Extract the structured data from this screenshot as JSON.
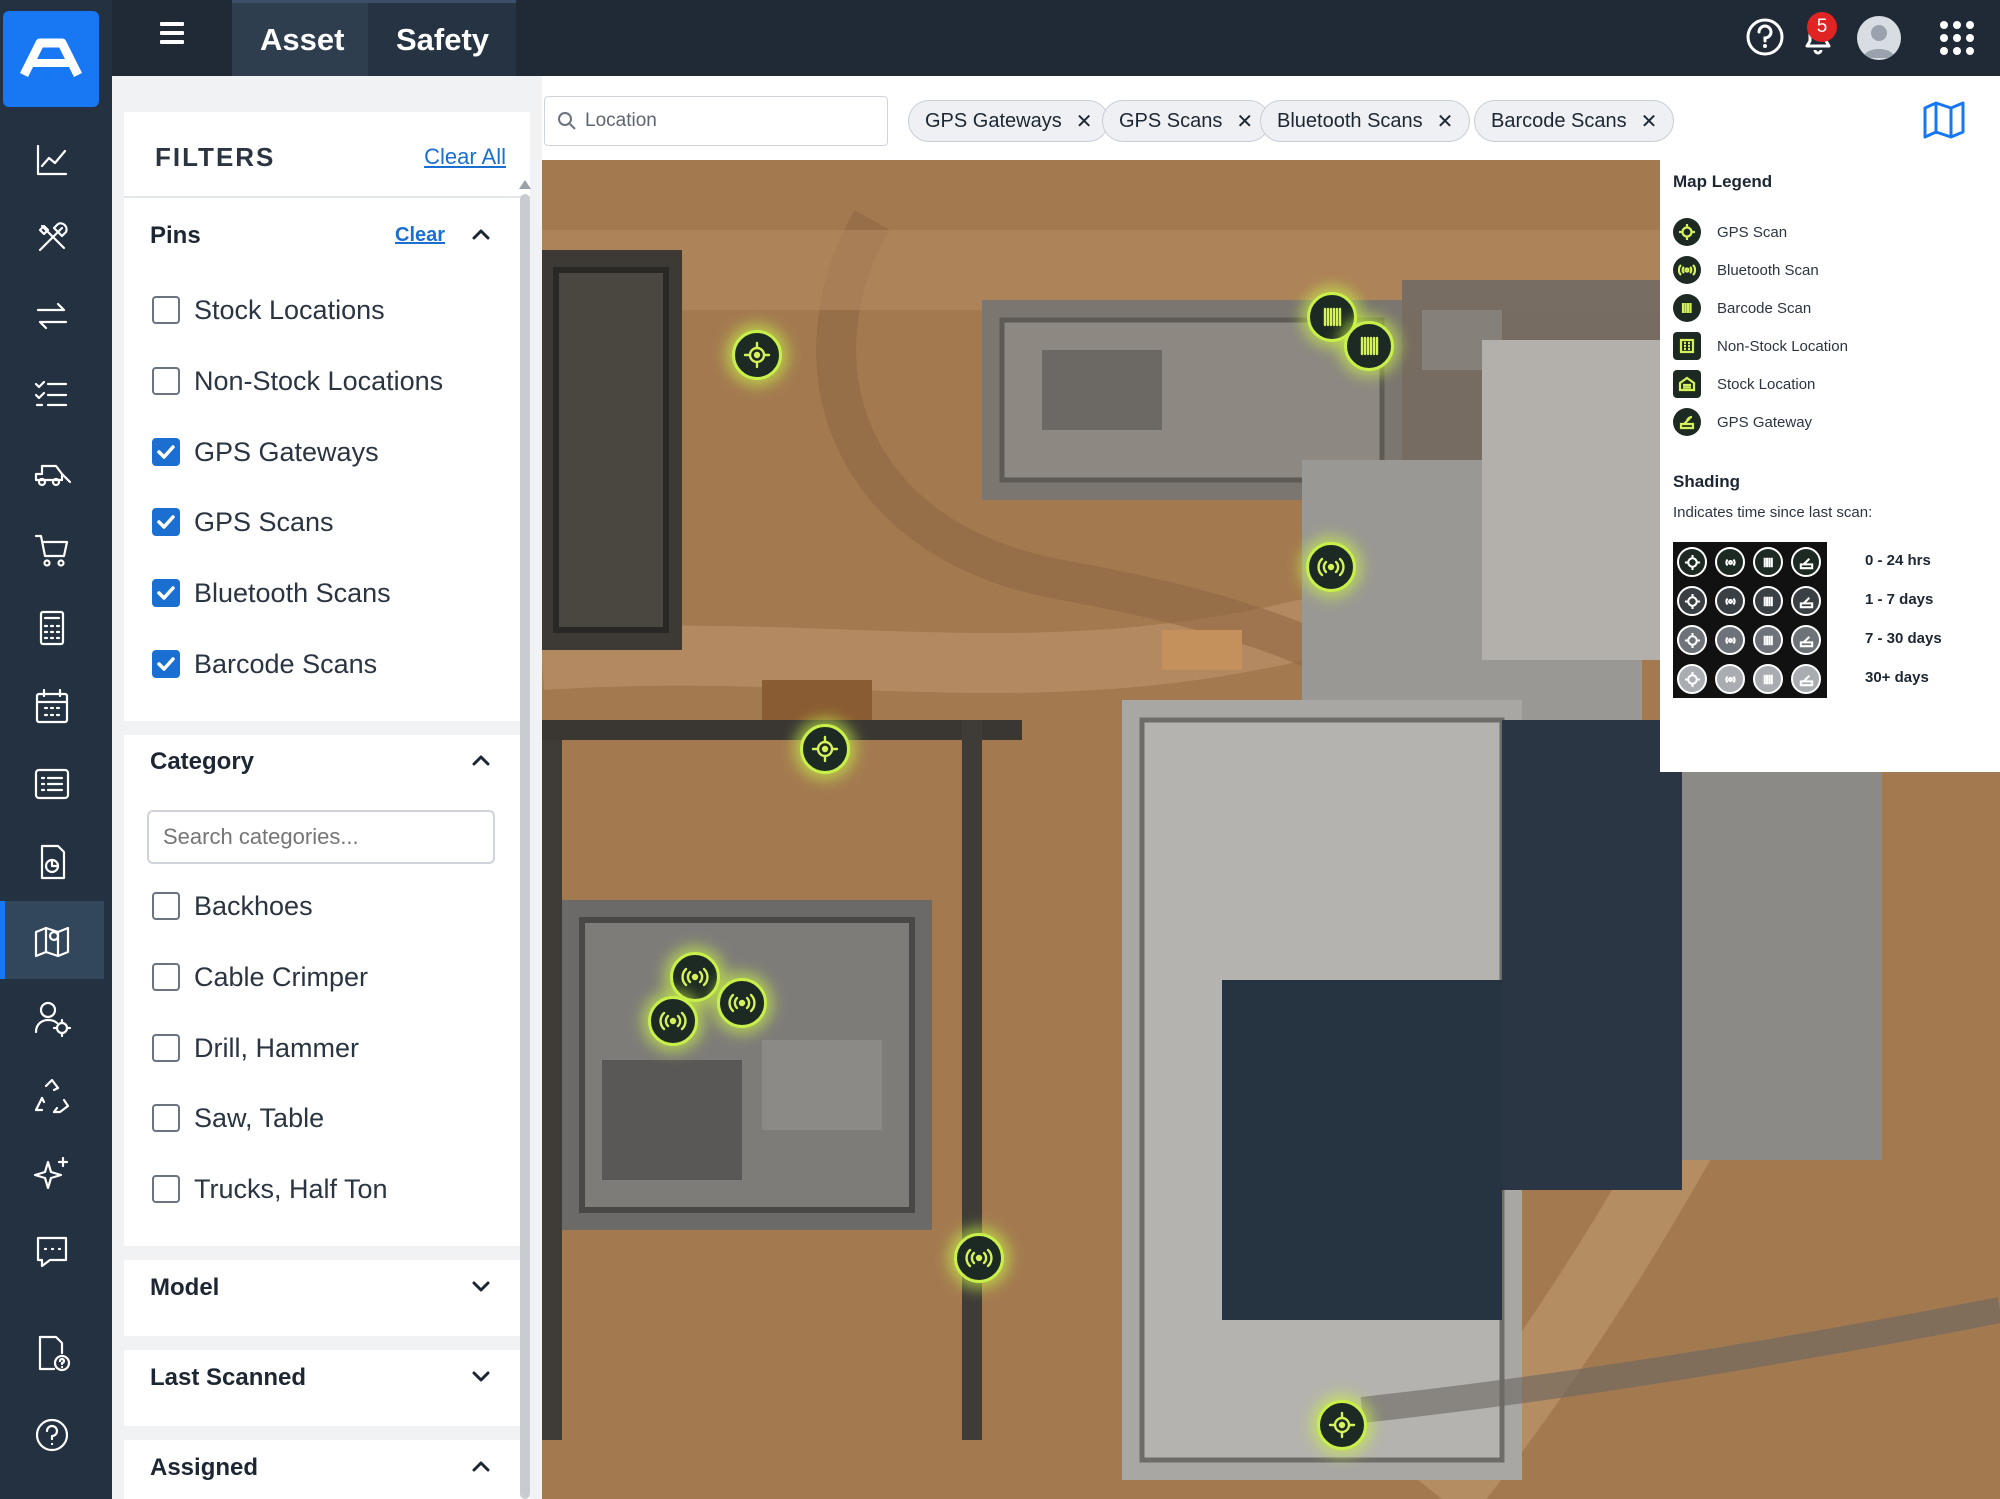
{
  "topbar": {
    "tabs": [
      {
        "label": "Asset",
        "active": true
      },
      {
        "label": "Safety",
        "active": false
      }
    ],
    "notification_count": "5",
    "icons": [
      "hamburger-icon",
      "help-icon",
      "bell-icon",
      "avatar",
      "app-grid-icon"
    ]
  },
  "rail": {
    "items": [
      "analytics-icon",
      "tools-icon",
      "transfer-icon",
      "checklist-icon",
      "equipment-icon",
      "cart-icon",
      "calculator-icon",
      "calendar-icon",
      "list-icon",
      "report-icon",
      "map-icon",
      "user-settings-icon",
      "recycle-icon",
      "sparkle-icon",
      "chat-icon",
      "document-help-icon",
      "help-icon"
    ],
    "active": "map-icon"
  },
  "filters": {
    "title": "FILTERS",
    "clear_all": "Clear All",
    "pins": {
      "heading": "Pins",
      "clear": "Clear",
      "items": [
        {
          "label": "Stock Locations",
          "checked": false
        },
        {
          "label": "Non-Stock Locations",
          "checked": false
        },
        {
          "label": "GPS Gateways",
          "checked": true
        },
        {
          "label": "GPS Scans",
          "checked": true
        },
        {
          "label": "Bluetooth Scans",
          "checked": true
        },
        {
          "label": "Barcode Scans",
          "checked": true
        }
      ]
    },
    "category": {
      "heading": "Category",
      "search_placeholder": "Search categories...",
      "items": [
        {
          "label": "Backhoes",
          "checked": false
        },
        {
          "label": "Cable Crimper",
          "checked": false
        },
        {
          "label": "Drill, Hammer",
          "checked": false
        },
        {
          "label": "Saw, Table",
          "checked": false
        },
        {
          "label": "Trucks, Half Ton",
          "checked": false
        }
      ]
    },
    "model": {
      "heading": "Model"
    },
    "last_scanned": {
      "heading": "Last Scanned"
    },
    "assigned": {
      "heading": "Assigned"
    }
  },
  "mapbar": {
    "location_placeholder": "Location",
    "chips": [
      "GPS Gateways",
      "GPS Scans",
      "Bluetooth Scans",
      "Barcode Scans"
    ]
  },
  "legend": {
    "title": "Map Legend",
    "items": [
      {
        "label": "GPS Scan",
        "icon": "gps-scan-icon"
      },
      {
        "label": "Bluetooth Scan",
        "icon": "bluetooth-scan-icon"
      },
      {
        "label": "Barcode Scan",
        "icon": "barcode-scan-icon"
      },
      {
        "label": "Non-Stock Location",
        "icon": "non-stock-location-icon"
      },
      {
        "label": "Stock Location",
        "icon": "stock-location-icon"
      },
      {
        "label": "GPS Gateway",
        "icon": "gps-gateway-icon"
      }
    ],
    "shading_title": "Shading",
    "shading_subtitle": "Indicates time since last scan:",
    "shading_levels": [
      "0 - 24 hrs",
      "1 - 7 days",
      "7 - 30 days",
      "30+ days"
    ],
    "shading_colors": [
      "#1d2a23",
      "#3a3f44",
      "#6e7379",
      "#a9adb2"
    ]
  },
  "colors": {
    "accent": "#1877f2",
    "pin_glow": "#c9f04a",
    "topbar": "#1f2a36"
  }
}
